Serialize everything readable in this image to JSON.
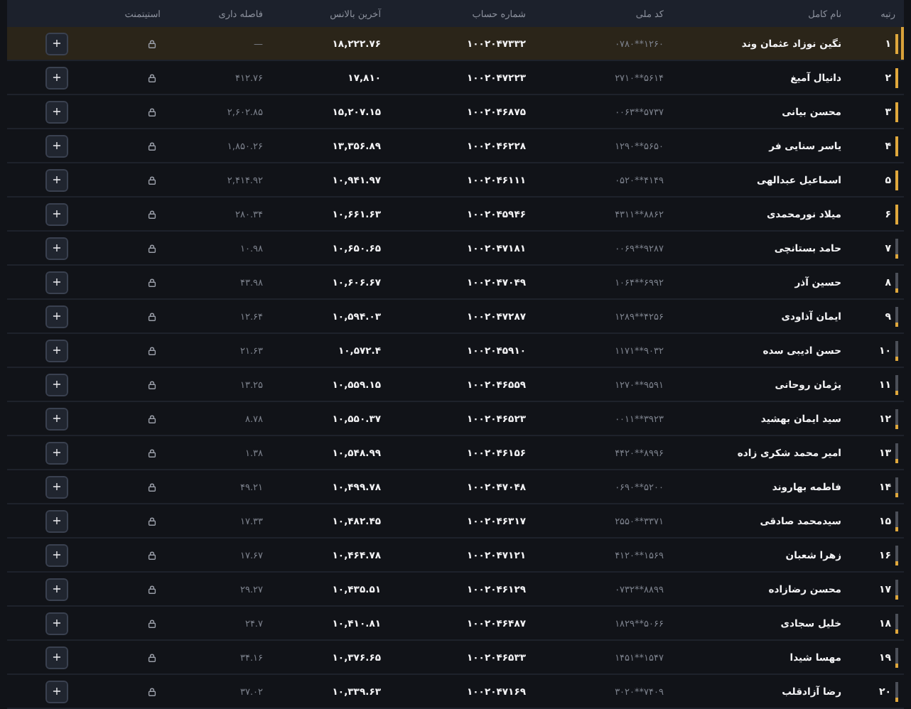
{
  "table": {
    "columns": [
      "رتبه",
      "نام کامل",
      "کد ملی",
      "شماره حساب",
      "آخرین بالانس",
      "فاصله داری",
      "استیتمنت"
    ],
    "rows": [
      {
        "rank": "۱",
        "level": 1,
        "selected": true,
        "name": "نگین نوزاد عثمان وند",
        "national_code": "۰۷۸۰**۱۲۶۰",
        "account": "۱۰۰۲۰۴۷۳۳۲",
        "balance": "۱۸,۲۲۲.۷۶",
        "gap": "—",
        "action": "+"
      },
      {
        "rank": "۲",
        "level": 1,
        "selected": false,
        "name": "دانیال آمیغ",
        "national_code": "۲۷۱۰**۵۶۱۴",
        "account": "۱۰۰۲۰۴۷۲۲۳",
        "balance": "۱۷,۸۱۰",
        "gap": "۴۱۲.۷۶",
        "action": "+"
      },
      {
        "rank": "۳",
        "level": 1,
        "selected": false,
        "name": "محسن بیانی",
        "national_code": "۰۰۶۳**۵۷۳۷",
        "account": "۱۰۰۲۰۴۶۸۷۵",
        "balance": "۱۵,۲۰۷.۱۵",
        "gap": "۲,۶۰۲.۸۵",
        "action": "+"
      },
      {
        "rank": "۴",
        "level": 1,
        "selected": false,
        "name": "یاسر سنایی فر",
        "national_code": "۱۲۹۰**۵۶۵۰",
        "account": "۱۰۰۲۰۴۶۲۲۸",
        "balance": "۱۳,۳۵۶.۸۹",
        "gap": "۱,۸۵۰.۲۶",
        "action": "+"
      },
      {
        "rank": "۵",
        "level": 1,
        "selected": false,
        "name": "اسماعیل عبدالهی",
        "national_code": "۰۵۲۰**۴۱۴۹",
        "account": "۱۰۰۲۰۴۶۱۱۱",
        "balance": "۱۰,۹۴۱.۹۷",
        "gap": "۲,۴۱۴.۹۲",
        "action": "+"
      },
      {
        "rank": "۶",
        "level": 1,
        "selected": false,
        "name": "میلاد نورمحمدی",
        "national_code": "۴۳۱۱**۸۸۶۲",
        "account": "۱۰۰۲۰۴۵۹۴۶",
        "balance": "۱۰,۶۶۱.۶۳",
        "gap": "۲۸۰.۳۴",
        "action": "+"
      },
      {
        "rank": "۷",
        "level": 0.15,
        "selected": false,
        "name": "حامد بستانچی",
        "national_code": "۰۰۶۹**۹۲۸۷",
        "account": "۱۰۰۲۰۴۷۱۸۱",
        "balance": "۱۰,۶۵۰.۶۵",
        "gap": "۱۰.۹۸",
        "action": "+"
      },
      {
        "rank": "۸",
        "level": 0.15,
        "selected": false,
        "name": "حسین آذر",
        "national_code": "۱۰۶۴**۶۹۹۲",
        "account": "۱۰۰۲۰۴۷۰۴۹",
        "balance": "۱۰,۶۰۶.۶۷",
        "gap": "۴۳.۹۸",
        "action": "+"
      },
      {
        "rank": "۹",
        "level": 0.15,
        "selected": false,
        "name": "ایمان آذاودی",
        "national_code": "۱۲۸۹**۴۲۵۶",
        "account": "۱۰۰۲۰۴۷۲۸۷",
        "balance": "۱۰,۵۹۴.۰۳",
        "gap": "۱۲.۶۴",
        "action": "+"
      },
      {
        "rank": "۱۰",
        "level": 0.15,
        "selected": false,
        "name": "حسن ادیبی سده",
        "national_code": "۱۱۷۱**۹۰۳۲",
        "account": "۱۰۰۲۰۴۵۹۱۰",
        "balance": "۱۰,۵۷۲.۴",
        "gap": "۲۱.۶۳",
        "action": "+"
      },
      {
        "rank": "۱۱",
        "level": 0.15,
        "selected": false,
        "name": "پژمان روحانی",
        "national_code": "۱۲۷۰**۹۵۹۱",
        "account": "۱۰۰۲۰۴۶۵۵۹",
        "balance": "۱۰,۵۵۹.۱۵",
        "gap": "۱۳.۲۵",
        "action": "+"
      },
      {
        "rank": "۱۲",
        "level": 0.15,
        "selected": false,
        "name": "سید ایمان بهشید",
        "national_code": "۰۰۱۱**۳۹۲۳",
        "account": "۱۰۰۲۰۴۶۵۲۳",
        "balance": "۱۰,۵۵۰.۳۷",
        "gap": "۸.۷۸",
        "action": "+"
      },
      {
        "rank": "۱۳",
        "level": 0.15,
        "selected": false,
        "name": "امیر محمد شکری زاده",
        "national_code": "۴۴۲۰**۸۹۹۶",
        "account": "۱۰۰۲۰۴۶۱۵۶",
        "balance": "۱۰,۵۴۸.۹۹",
        "gap": "۱.۳۸",
        "action": "+"
      },
      {
        "rank": "۱۴",
        "level": 0.15,
        "selected": false,
        "name": "فاطمه بهاروند",
        "national_code": "۰۶۹۰**۵۲۰۰",
        "account": "۱۰۰۲۰۴۷۰۴۸",
        "balance": "۱۰,۴۹۹.۷۸",
        "gap": "۴۹.۲۱",
        "action": "+"
      },
      {
        "rank": "۱۵",
        "level": 0.15,
        "selected": false,
        "name": "سیدمحمد صادقی",
        "national_code": "۲۵۵۰**۳۳۷۱",
        "account": "۱۰۰۲۰۴۶۳۱۷",
        "balance": "۱۰,۴۸۲.۴۵",
        "gap": "۱۷.۳۳",
        "action": "+"
      },
      {
        "rank": "۱۶",
        "level": 0.15,
        "selected": false,
        "name": "زهرا شعبان",
        "national_code": "۴۱۲۰**۱۵۶۹",
        "account": "۱۰۰۲۰۴۷۱۲۱",
        "balance": "۱۰,۴۶۴.۷۸",
        "gap": "۱۷.۶۷",
        "action": "+"
      },
      {
        "rank": "۱۷",
        "level": 0.15,
        "selected": false,
        "name": "محسن رضازاده",
        "national_code": "۰۷۳۲**۸۸۹۹",
        "account": "۱۰۰۲۰۴۶۱۲۹",
        "balance": "۱۰,۴۳۵.۵۱",
        "gap": "۲۹.۲۷",
        "action": "+"
      },
      {
        "rank": "۱۸",
        "level": 0.15,
        "selected": false,
        "name": "خلیل سجادی",
        "national_code": "۱۸۲۹**۵۰۶۶",
        "account": "۱۰۰۲۰۴۶۴۸۷",
        "balance": "۱۰,۴۱۰.۸۱",
        "gap": "۲۴.۷",
        "action": "+"
      },
      {
        "rank": "۱۹",
        "level": 0.15,
        "selected": false,
        "name": "مهسا شیدا",
        "national_code": "۱۴۵۱**۱۵۴۷",
        "account": "۱۰۰۲۰۴۶۵۳۳",
        "balance": "۱۰,۳۷۶.۶۵",
        "gap": "۳۴.۱۶",
        "action": "+"
      },
      {
        "rank": "۲۰",
        "level": 0.15,
        "selected": false,
        "name": "رضا آزادقلب",
        "national_code": "۳۰۲۰**۷۴۰۹",
        "account": "۱۰۰۲۰۴۷۱۶۹",
        "balance": "۱۰,۳۳۹.۶۳",
        "gap": "۳۷.۰۲",
        "action": "+"
      }
    ]
  }
}
